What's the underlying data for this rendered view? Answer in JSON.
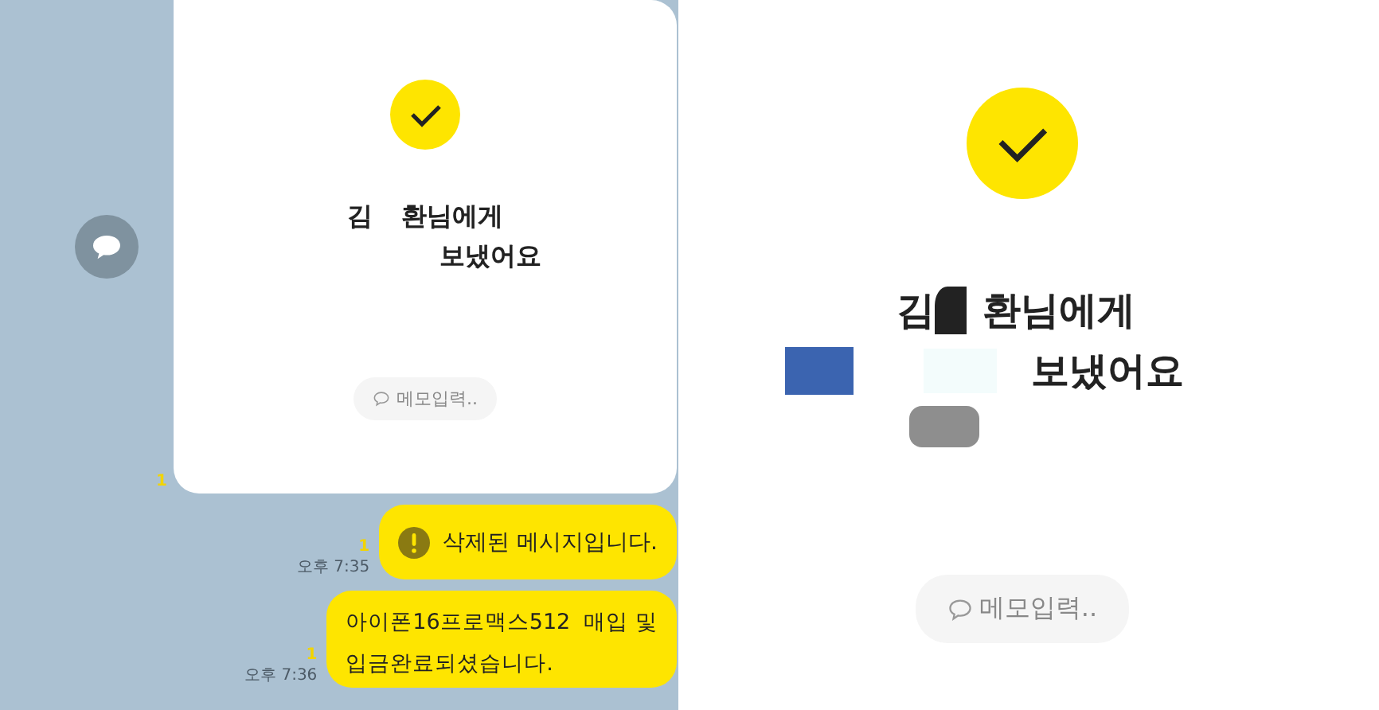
{
  "chat": {
    "read_count": "1",
    "card": {
      "name_start": "김",
      "name_end": "환님에게",
      "line2": "보냈어요",
      "memo_placeholder": "메모입력.."
    },
    "messages": [
      {
        "kind": "deleted",
        "text": "삭제된 메시지입니다.",
        "read_count": "1",
        "time": "오후 7:35"
      },
      {
        "kind": "text",
        "lines": [
          "아이폰16프로맥스512  매입 및",
          "입금완료되셨습니다."
        ],
        "read_count": "1",
        "time": "오후 7:36"
      }
    ]
  },
  "detail": {
    "name_start": "김",
    "name_end": "환님에게",
    "line2": "보냈어요",
    "memo_placeholder": "메모입력.."
  }
}
